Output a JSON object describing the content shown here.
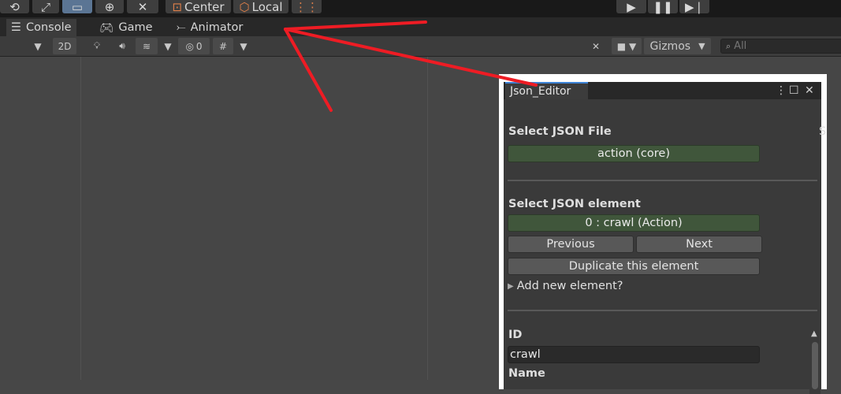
{
  "toolbar": {
    "pivot_center_label": "Center",
    "pivot_space_label": "Local"
  },
  "tabs": [
    {
      "label": "Console",
      "icon": "list-icon"
    },
    {
      "label": "Game",
      "icon": "gamepad-icon"
    },
    {
      "label": "Animator",
      "icon": "animator-icon"
    }
  ],
  "scene_toolbar": {
    "mode_2d_label": "2D",
    "hidden_count": "0",
    "gizmos_label": "Gizmos",
    "search_placeholder": "All"
  },
  "json_editor": {
    "tab_title": "Json_Editor",
    "select_file_label": "Select JSON File",
    "selected_file": "action (core)",
    "select_element_label": "Select JSON element",
    "selected_element": "0 : crawl (Action)",
    "previous_label": "Previous",
    "next_label": "Next",
    "duplicate_label": "Duplicate this element",
    "add_new_label": "Add new element?",
    "id_label": "ID",
    "id_value": "crawl",
    "name_label": "Name",
    "clipped_letter": "S"
  },
  "colors": {
    "accent_blue": "#3d83d6",
    "annotation_red": "#ee1c24",
    "field_green": "#40563b"
  }
}
